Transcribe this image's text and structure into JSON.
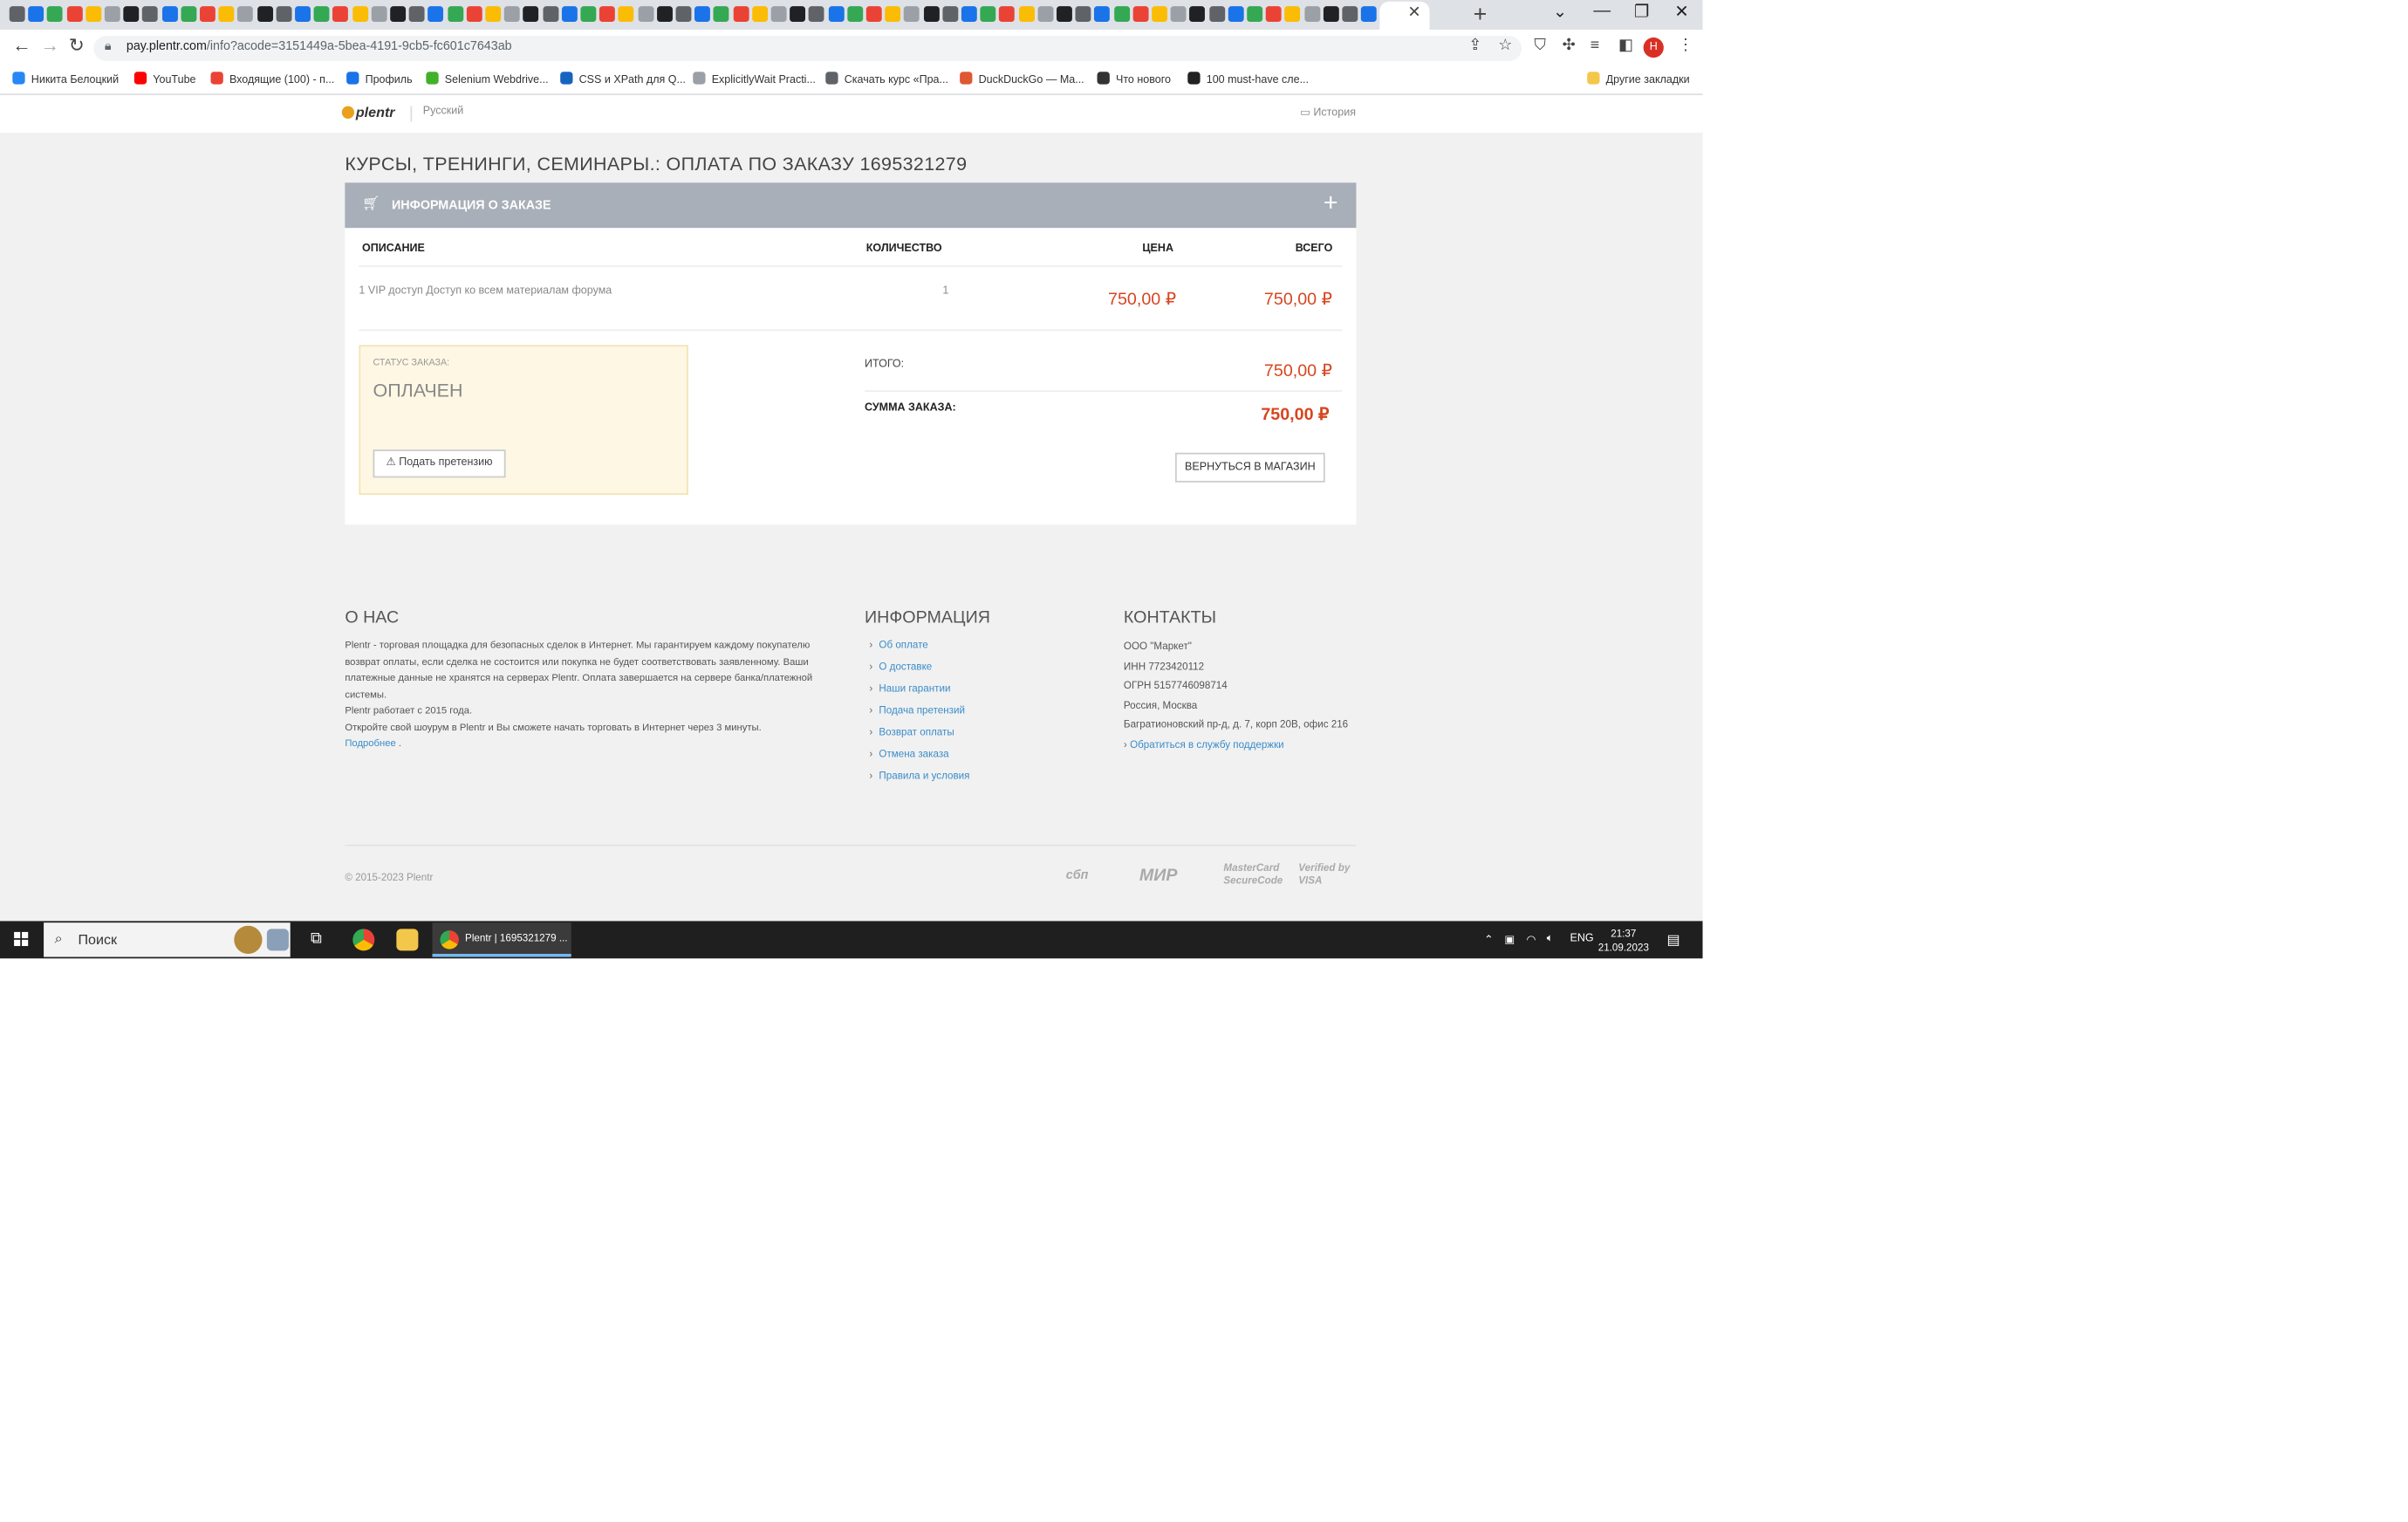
{
  "browser": {
    "url_host": "pay.plentr.com",
    "url_path": "/info?acode=3151449a-5bea-4191-9cb5-fc601c7643ab",
    "bookmarks": [
      {
        "label": "Никита Белоцкий",
        "color": "#2787f5"
      },
      {
        "label": "YouTube",
        "color": "#ff0000"
      },
      {
        "label": "Входящие (100) - п...",
        "color": "#ea4335"
      },
      {
        "label": "Профиль",
        "color": "#1a73e8"
      },
      {
        "label": "Selenium Webdrive...",
        "color": "#43b02a"
      },
      {
        "label": "CSS и XPath для Q...",
        "color": "#1565c0"
      },
      {
        "label": "ExplicitlyWait Practi...",
        "color": "#9aa0a6"
      },
      {
        "label": "Скачать курс «Пра...",
        "color": "#5f6368"
      },
      {
        "label": "DuckDuckGo — Ma...",
        "color": "#de5833"
      },
      {
        "label": "Что нового",
        "color": "#333333"
      },
      {
        "label": "100 must-have слe...",
        "color": "#222222"
      }
    ],
    "other_bookmarks": "Другие закладки",
    "profile_initial": "Н"
  },
  "header": {
    "logo": "plentr",
    "language": "Русский",
    "history": "История"
  },
  "order": {
    "page_title": "КУРСЫ, ТРЕНИНГИ, СЕМИНАРЫ.: ОПЛАТА ПО ЗАКАЗУ 1695321279",
    "panel_title": "ИНФОРМАЦИЯ О ЗАКАЗЕ",
    "columns": {
      "description": "ОПИСАНИЕ",
      "quantity": "КОЛИЧЕСТВО",
      "price": "ЦЕНА",
      "total": "ВСЕГО"
    },
    "item": {
      "description": "1 VIP доступ Доступ ко всем материалам форума",
      "quantity": "1",
      "price": "750,00 ₽",
      "total": "750,00 ₽"
    },
    "status_label": "СТАТУС ЗАКАЗА:",
    "status_value": "ОПЛАЧЕН",
    "claim_button": "Подать претензию",
    "subtotal_label": "ИТОГО:",
    "subtotal_value": "750,00 ₽",
    "sum_label": "СУММА ЗАКАЗА:",
    "sum_value": "750,00 ₽",
    "back_button": "ВЕРНУТЬСЯ В МАГАЗИН"
  },
  "footer": {
    "about_title": "О НАС",
    "about_p1": "Plentr - торговая площадка для безопасных сделок в Интернет. Мы гарантируем каждому покупателю возврат оплаты, если сделка не состоится или покупка не будет соответствовать заявленному. Ваши платежные данные не хранятся на серверах Plentr. Оплата завершается на сервере банка/платежной системы.",
    "about_p2": "Plentr работает с 2015 года.",
    "about_p3": "Откройте свой шоурум в Plentr и Вы сможете начать торговать в Интернет через 3 минуты.",
    "about_more": "Подробнее",
    "info_title": "ИНФОРМАЦИЯ",
    "info_links": [
      "Об оплате",
      "О доставке",
      "Наши гарантии",
      "Подача претензий",
      "Возврат оплаты",
      "Отмена заказа",
      "Правила и условия"
    ],
    "contacts_title": "КОНТАКТЫ",
    "company": "ООО \"Маркет\"",
    "inn": "ИНН 7723420112",
    "ogrn": "ОГРН 5157746098714",
    "city": "Россия, Москва",
    "address": "Багратионовский пр-д, д. 7, корп 20В, офис 216",
    "support_link": "Обратиться в службу поддержки",
    "copyright": "© 2015-2023 Plentr",
    "pay_logos": [
      "сбп",
      "МИР",
      "MasterCard SecureCode",
      "Verified by VISA"
    ]
  },
  "taskbar": {
    "search_placeholder": "Поиск",
    "active_window": "Plentr | 1695321279 ...",
    "lang": "ENG",
    "time": "21:37",
    "date": "21.09.2023"
  }
}
